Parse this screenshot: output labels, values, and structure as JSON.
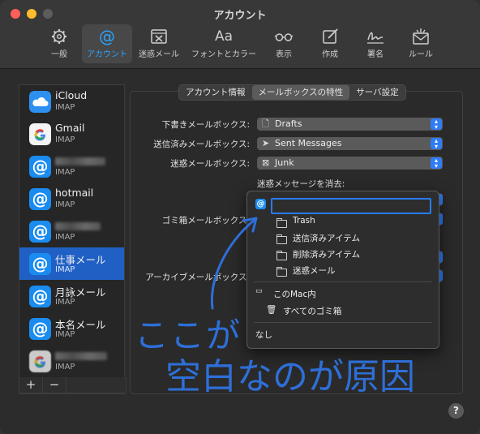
{
  "window": {
    "title": "アカウント"
  },
  "toolbar": {
    "items": [
      {
        "label": "一般",
        "icon": "gear-icon"
      },
      {
        "label": "アカウント",
        "icon": "at-icon"
      },
      {
        "label": "迷惑メール",
        "icon": "junk-tray-icon"
      },
      {
        "label": "フォントとカラー",
        "icon": "font-icon",
        "glyph": "Aa"
      },
      {
        "label": "表示",
        "icon": "glasses-icon"
      },
      {
        "label": "作成",
        "icon": "compose-icon"
      },
      {
        "label": "署名",
        "icon": "signature-icon"
      },
      {
        "label": "ルール",
        "icon": "rules-envelope-icon"
      }
    ],
    "active_index": 1
  },
  "sidebar": {
    "accounts": [
      {
        "name": "iCloud",
        "type": "IMAP",
        "icon": "icloud-icon"
      },
      {
        "name": "Gmail",
        "type": "IMAP",
        "icon": "gmail-icon"
      },
      {
        "name": "",
        "type": "IMAP",
        "icon": "at-icon"
      },
      {
        "name": "hotmail",
        "type": "IMAP",
        "icon": "at-icon"
      },
      {
        "name": "",
        "type": "IMAP",
        "icon": "at-icon"
      },
      {
        "name": "仕事メール",
        "type": "IMAP",
        "icon": "at-icon",
        "selected": true
      },
      {
        "name": "月詠メール",
        "type": "IMAP",
        "icon": "at-icon"
      },
      {
        "name": "本名メール",
        "type": "IMAP",
        "icon": "at-icon"
      },
      {
        "name": "",
        "type": "IMAP",
        "icon": "gmail-icon"
      }
    ],
    "add_label": "+",
    "remove_label": "−"
  },
  "tabs": [
    {
      "label": "アカウント情報"
    },
    {
      "label": "メールボックスの特性",
      "active": true
    },
    {
      "label": "サーバ設定"
    }
  ],
  "form": {
    "drafts_label": "下書きメールボックス:",
    "drafts_value": "Drafts",
    "sent_label": "送信済みメールボックス:",
    "sent_value": "Sent Messages",
    "junk_label": "迷惑メールボックス:",
    "junk_value": "Junk",
    "erase_junk_label": "迷惑メッセージを消去:",
    "trash_label": "ゴミ箱メールボックス:",
    "archive_label": "アーカイブメールボックス:"
  },
  "menu": {
    "input_value": "",
    "folders": [
      "Trash",
      "送信済みアイテム",
      "削除済みアイテム",
      "迷惑メール"
    ],
    "on_my_mac": "このMac内",
    "all_trash": "すべてのゴミ箱",
    "none": "なし"
  },
  "annotation": {
    "line1": "ここが",
    "line2": "空白なのが原因",
    "color": "#2e6fd8"
  },
  "help_label": "?"
}
